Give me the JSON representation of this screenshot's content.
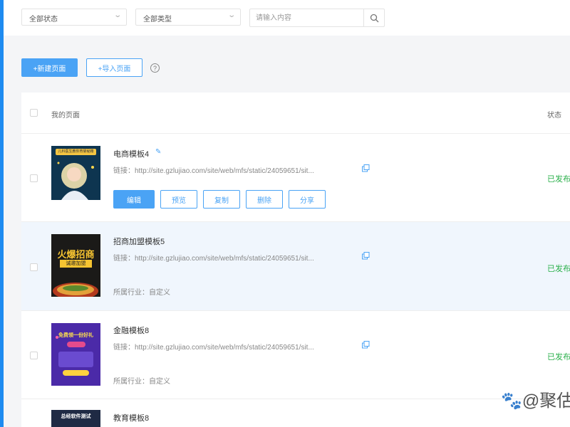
{
  "filters": {
    "status_value": "全部状态",
    "type_value": "全部类型",
    "search_placeholder": "请输入内容"
  },
  "toolbar": {
    "new_page_label": "+新建页面",
    "import_page_label": "+导入页面",
    "help_label": "?"
  },
  "table": {
    "header_label": "我的页面",
    "status_header": "状态"
  },
  "rows": [
    {
      "title": "电商模板4",
      "link": "链接：http://site.gzlujiao.com/site/web/mfs/static/24059651/sit...",
      "status": "已发布",
      "ops": [
        "编辑",
        "预览",
        "复制",
        "删除",
        "分享"
      ],
      "thumb_text": "儿科医生教你育婴秘籍"
    },
    {
      "title": "招商加盟模板5",
      "link": "链接：http://site.gzlujiao.com/site/web/mfs/static/24059651/sit...",
      "industry": "所属行业：自定义",
      "status": "已发布",
      "thumb_text_1": "火爆招商",
      "thumb_text_2": "诚邀加盟"
    },
    {
      "title": "金融模板8",
      "link": "链接：http://site.gzlujiao.com/site/web/mfs/static/24059651/sit...",
      "industry": "所属行业：自定义",
      "status": "已发布",
      "thumb_text": "免费领一份好礼"
    },
    {
      "title": "教育模板8",
      "thumb_text": "总经软件测试"
    }
  ],
  "watermark": "@聚估",
  "colors": {
    "accent": "#4aa3f5",
    "status_green": "#2bb04b",
    "row_highlight": "#f0f6fd"
  }
}
